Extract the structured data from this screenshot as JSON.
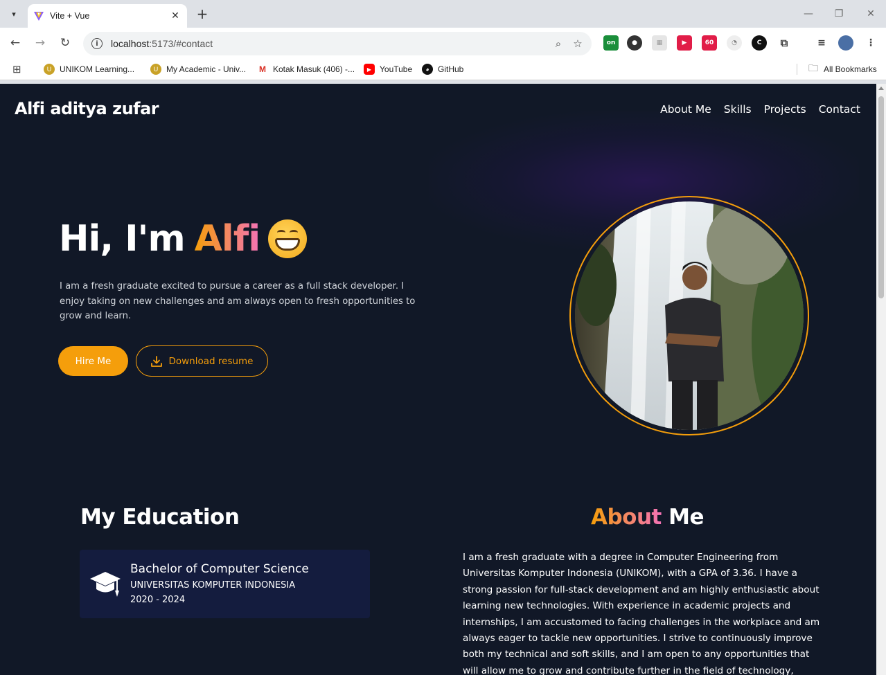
{
  "browser": {
    "tab_title": "Vite + Vue",
    "url_host": "localhost",
    "url_rest": ":5173/#contact",
    "bookmarks": [
      {
        "label": "UNIKOM Learning...",
        "icon": "unikom-icon"
      },
      {
        "label": "My Academic - Univ...",
        "icon": "unikom-icon"
      },
      {
        "label": "Kotak Masuk (406) -...",
        "icon": "gmail-icon"
      },
      {
        "label": "YouTube",
        "icon": "youtube-icon"
      },
      {
        "label": "GitHub",
        "icon": "github-icon"
      }
    ],
    "all_bookmarks": "All Bookmarks"
  },
  "site": {
    "brand": "Alfi aditya zufar",
    "nav": [
      "About Me",
      "Skills",
      "Projects",
      "Contact"
    ]
  },
  "hero": {
    "greeting": "Hi, I'm",
    "name": "Alfi",
    "description": "I am a fresh graduate excited to pursue a career as a full stack developer. I enjoy taking on new challenges and am always open to fresh opportunities to grow and learn.",
    "hire_label": "Hire Me",
    "resume_label": "Download resume"
  },
  "education": {
    "title": "My Education",
    "degree": "Bachelor of Computer Science",
    "school": "UNIVERSITAS KOMPUTER INDONESIA",
    "years": "2020 - 2024"
  },
  "about": {
    "title_accent": "About",
    "title_rest": "Me",
    "text": "I am a fresh graduate with a degree in Computer Engineering from Universitas Komputer Indonesia (UNIKOM), with a GPA of 3.36. I have a strong passion for full-stack development and am highly enthusiastic about learning new technologies. With experience in academic projects and internships, I am accustomed to facing challenges in the workplace and am always eager to tackle new opportunities. I strive to continuously improve both my technical and soft skills, and I am open to any opportunities that will allow me to grow and contribute further in the field of technology, particularly in application"
  },
  "colors": {
    "page_bg": "#111827",
    "accent": "#f59e0b",
    "accent_pink": "#f472b6",
    "card_bg": "#141c3e"
  }
}
